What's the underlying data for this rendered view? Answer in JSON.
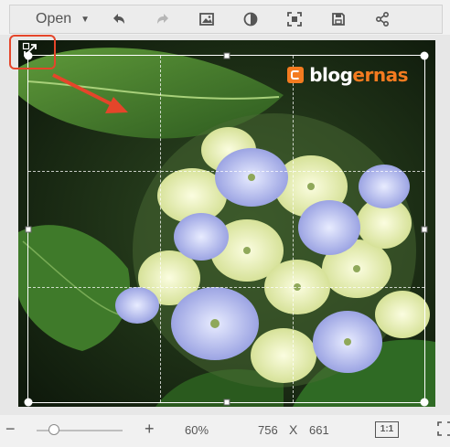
{
  "toolbar": {
    "open_label": "Open",
    "buttons": [
      {
        "icon": "undo-icon",
        "enabled": true
      },
      {
        "icon": "redo-icon",
        "enabled": false
      },
      {
        "icon": "image-icon",
        "enabled": true
      },
      {
        "icon": "adjust-icon",
        "enabled": true
      },
      {
        "icon": "crop-focus-icon",
        "enabled": true
      },
      {
        "icon": "save-icon",
        "enabled": true
      },
      {
        "icon": "share-icon",
        "enabled": true
      }
    ]
  },
  "watermark": {
    "part1": "blog",
    "part2": "ernas"
  },
  "annotation": {
    "highlight_color": "#e5452a"
  },
  "footer": {
    "minus_label": "−",
    "plus_label": "+",
    "zoom_level": "60%",
    "slider_value": 0.2,
    "width": "756",
    "times": "X",
    "height": "661",
    "ratio_label": "1:1"
  },
  "colors": {
    "accent": "#f47b20",
    "arrow": "#e5452a"
  }
}
